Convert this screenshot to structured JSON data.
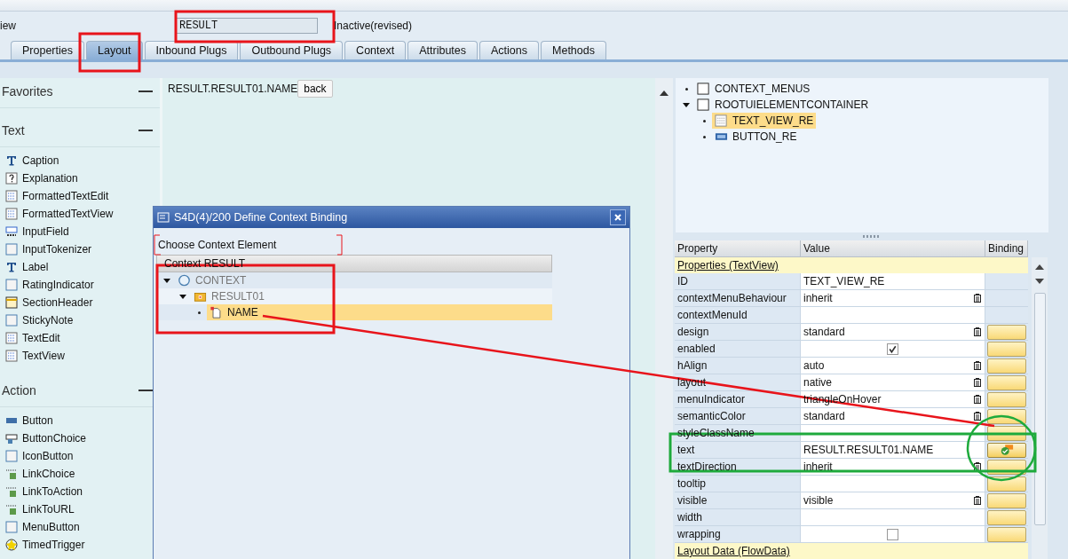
{
  "header": {
    "view_label": "iew",
    "name_field": "RESULT",
    "status": "Inactive(revised)"
  },
  "tabs": [
    {
      "label": "Properties",
      "selected": false
    },
    {
      "label": "Layout",
      "selected": true
    },
    {
      "label": "Inbound Plugs",
      "selected": false
    },
    {
      "label": "Outbound Plugs",
      "selected": false
    },
    {
      "label": "Context",
      "selected": false
    },
    {
      "label": "Attributes",
      "selected": false
    },
    {
      "label": "Actions",
      "selected": false
    },
    {
      "label": "Methods",
      "selected": false
    }
  ],
  "palette": [
    {
      "title": "Favorites"
    },
    {
      "title": "Text",
      "items": [
        {
          "label": "Caption",
          "kind": "t"
        },
        {
          "label": "Explanation",
          "kind": "help"
        },
        {
          "label": "FormattedTextEdit",
          "kind": "lines"
        },
        {
          "label": "FormattedTextView",
          "kind": "lines"
        },
        {
          "label": "InputField",
          "kind": "input"
        },
        {
          "label": "InputTokenizer",
          "kind": "box"
        },
        {
          "label": "Label",
          "kind": "t"
        },
        {
          "label": "RatingIndicator",
          "kind": "box"
        },
        {
          "label": "SectionHeader",
          "kind": "note"
        },
        {
          "label": "StickyNote",
          "kind": "box"
        },
        {
          "label": "TextEdit",
          "kind": "lines"
        },
        {
          "label": "TextView",
          "kind": "lines"
        }
      ]
    },
    {
      "title": "Action",
      "items": [
        {
          "label": "Button",
          "kind": "button"
        },
        {
          "label": "ButtonChoice",
          "kind": "choice"
        },
        {
          "label": "IconButton",
          "kind": "box"
        },
        {
          "label": "LinkChoice",
          "kind": "link"
        },
        {
          "label": "LinkToAction",
          "kind": "link"
        },
        {
          "label": "LinkToURL",
          "kind": "link"
        },
        {
          "label": "MenuButton",
          "kind": "box"
        },
        {
          "label": "TimedTrigger",
          "kind": "star"
        }
      ]
    }
  ],
  "canvas": {
    "bound_text": "RESULT.RESULT01.NAME",
    "button": "back"
  },
  "ui_tree": [
    {
      "label": "CONTEXT_MENUS",
      "kind": "container",
      "selected": false
    },
    {
      "label": "ROOTUIELEMENTCONTAINER",
      "kind": "container",
      "expanded": true,
      "selected": false,
      "children": [
        {
          "label": "TEXT_VIEW_RE",
          "kind": "textview",
          "selected": true
        },
        {
          "label": "BUTTON_RE",
          "kind": "button",
          "selected": false
        }
      ]
    }
  ],
  "properties": {
    "columns": [
      "Property",
      "Value",
      "Binding"
    ],
    "group": "Properties (TextView)",
    "rows": [
      {
        "name": "ID",
        "kind": "text",
        "value": "TEXT_VIEW_RE"
      },
      {
        "name": "contextMenuBehaviour",
        "kind": "dropdown",
        "value": "inherit"
      },
      {
        "name": "contextMenuId",
        "kind": "text"
      },
      {
        "name": "design",
        "kind": "dropdown",
        "value": "standard",
        "binding": {
          "kind": "unbound"
        }
      },
      {
        "name": "enabled",
        "kind": "checkbox",
        "checked": true,
        "binding": {
          "kind": "unbound"
        }
      },
      {
        "name": "hAlign",
        "kind": "dropdown",
        "value": "auto",
        "binding": {
          "kind": "unbound"
        }
      },
      {
        "name": "layout",
        "kind": "dropdown",
        "value": "native",
        "binding": {
          "kind": "unbound"
        }
      },
      {
        "name": "menuIndicator",
        "kind": "dropdown",
        "value": "triangleOnHover",
        "binding": {
          "kind": "unbound"
        }
      },
      {
        "name": "semanticColor",
        "kind": "dropdown",
        "value": "standard",
        "binding": {
          "kind": "unbound"
        }
      },
      {
        "name": "styleClassName",
        "kind": "text",
        "binding": {
          "kind": "unbound"
        }
      },
      {
        "name": "text",
        "kind": "text",
        "value": "RESULT.RESULT01.NAME",
        "binding": {
          "kind": "bound"
        }
      },
      {
        "name": "textDirection",
        "kind": "dropdown",
        "value": "inherit",
        "binding": {
          "kind": "unbound"
        }
      },
      {
        "name": "tooltip",
        "kind": "text",
        "binding": {
          "kind": "unbound"
        }
      },
      {
        "name": "visible",
        "kind": "dropdown",
        "value": "visible",
        "binding": {
          "kind": "unbound"
        }
      },
      {
        "name": "width",
        "kind": "text",
        "binding": {
          "kind": "unbound"
        }
      },
      {
        "name": "wrapping",
        "kind": "checkbox",
        "checked": false,
        "binding": {
          "kind": "unbound"
        }
      }
    ],
    "footer_group": "Layout Data (FlowData)"
  },
  "dialog": {
    "title": "S4D(4)/200 Define Context Binding",
    "subtitle": "Choose Context Element",
    "tree_header": "Context RESULT",
    "nodes": [
      {
        "label": "CONTEXT",
        "kind": "context",
        "expanded": true,
        "selected": false,
        "children": [
          {
            "label": "RESULT01",
            "kind": "folder",
            "expanded": true,
            "selected": false,
            "children": [
              {
                "label": "NAME",
                "kind": "attribute",
                "selected": true
              }
            ]
          }
        ]
      }
    ]
  }
}
